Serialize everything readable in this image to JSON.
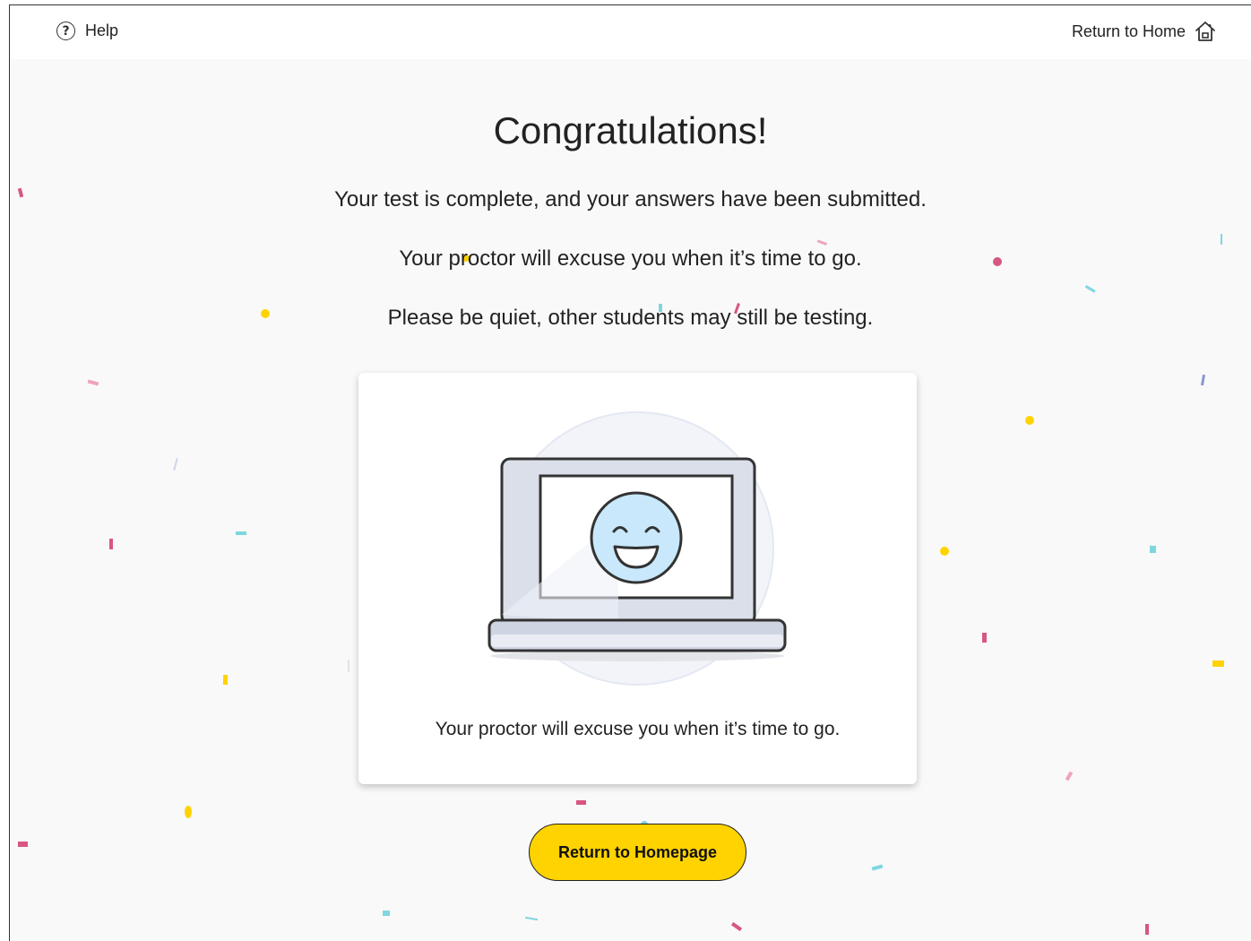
{
  "header": {
    "help_label": "Help",
    "return_home_label": "Return to Home"
  },
  "main": {
    "title": "Congratulations!",
    "lines": [
      "Your test is complete, and your answers have been submitted.",
      "Your proctor will excuse you when it’s time to go.",
      "Please be quiet, other students may still be testing."
    ],
    "card_text": "Your proctor will excuse you when it’s time to go.",
    "button_label": "Return to Homepage"
  },
  "icons": {
    "help": "question-circle-icon",
    "home": "house-icon",
    "illustration": "smiling-laptop-illustration"
  },
  "colors": {
    "accent": "#ffd300",
    "background": "#f9f9f9",
    "text": "#222222",
    "confetti": [
      "#ffd300",
      "#d6577f",
      "#7fd6e0",
      "#8a97d6"
    ]
  }
}
